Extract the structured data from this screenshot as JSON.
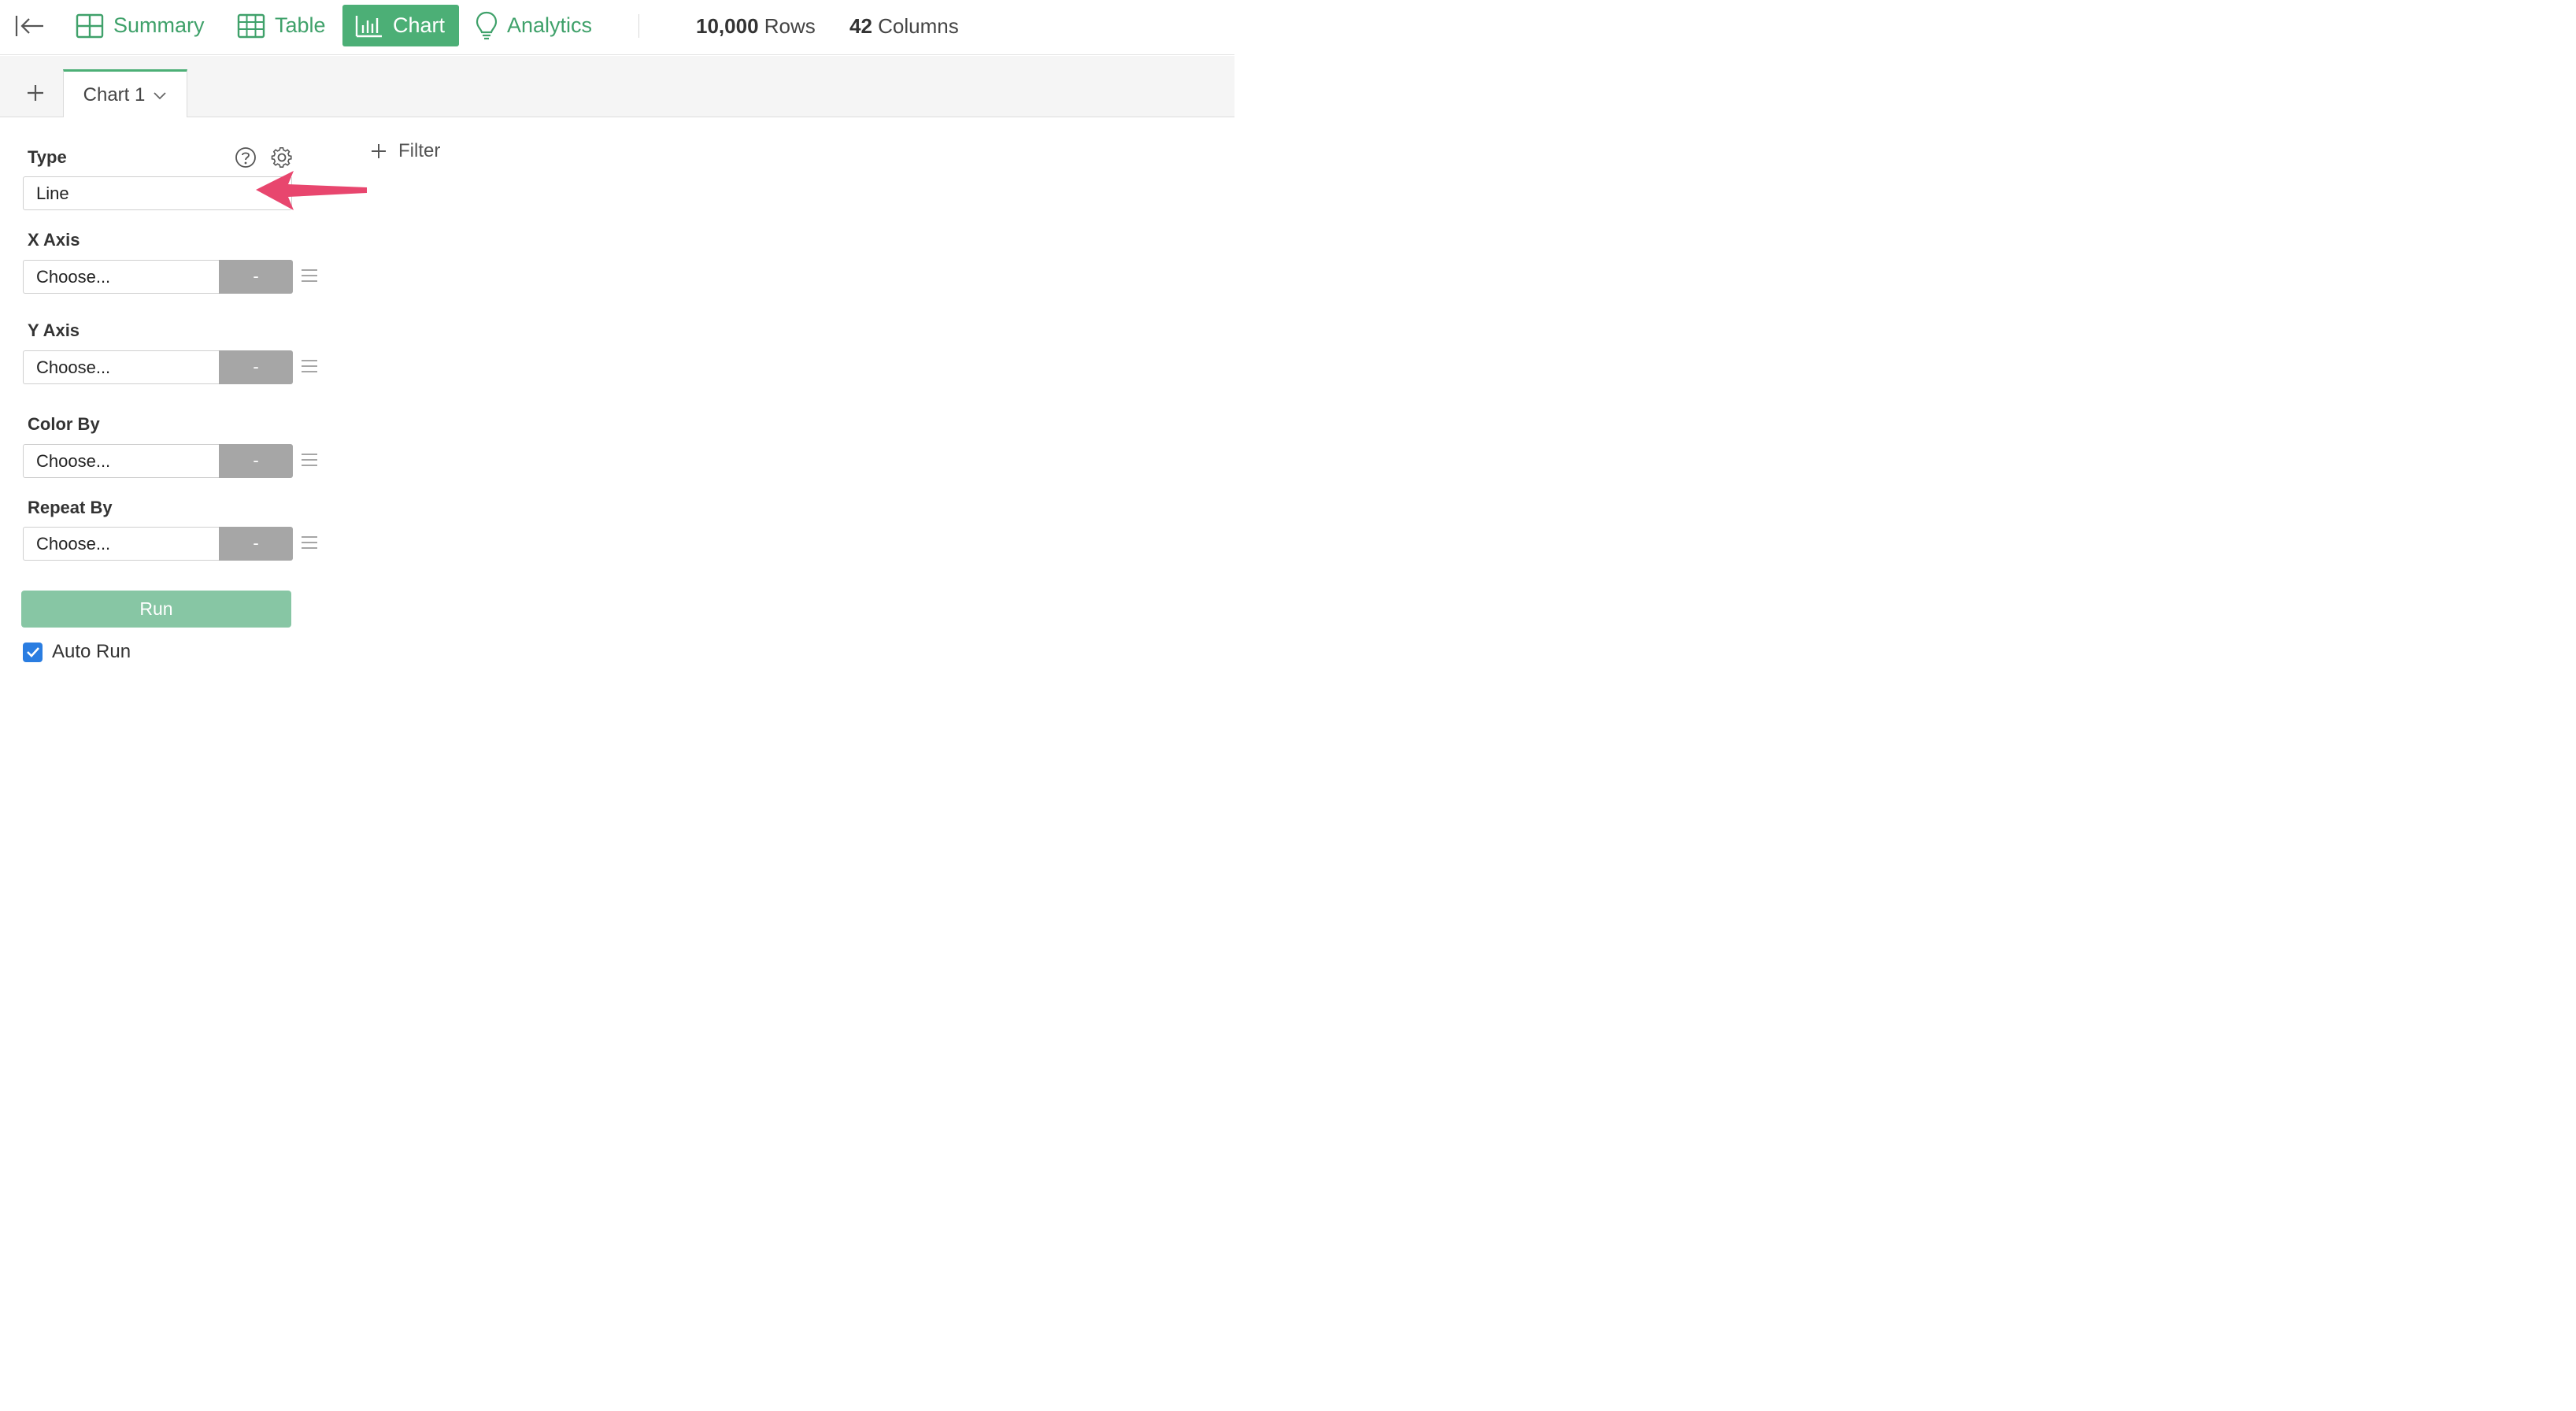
{
  "topbar": {
    "nav": [
      {
        "label": "Summary"
      },
      {
        "label": "Table"
      },
      {
        "label": "Chart",
        "active": true
      },
      {
        "label": "Analytics"
      }
    ],
    "rows_count": "10,000",
    "rows_label": "Rows",
    "cols_count": "42",
    "cols_label": "Columns"
  },
  "tabs": [
    {
      "label": "Chart 1"
    }
  ],
  "config": {
    "type_label": "Type",
    "type_value": "Line",
    "x_axis": {
      "label": "X Axis",
      "value": "Choose...",
      "agg": "-"
    },
    "y_axis": {
      "label": "Y Axis",
      "value": "Choose...",
      "agg": "-"
    },
    "color_by": {
      "label": "Color By",
      "value": "Choose...",
      "agg": "-"
    },
    "repeat_by": {
      "label": "Repeat By",
      "value": "Choose...",
      "agg": "-"
    },
    "run_label": "Run",
    "auto_run_label": "Auto Run",
    "auto_run_checked": true
  },
  "filter_label": "Filter",
  "colors": {
    "accent": "#4caf76",
    "run_button": "#87c6a4",
    "annotation_arrow": "#e8466e",
    "checkbox": "#2a7de1"
  }
}
